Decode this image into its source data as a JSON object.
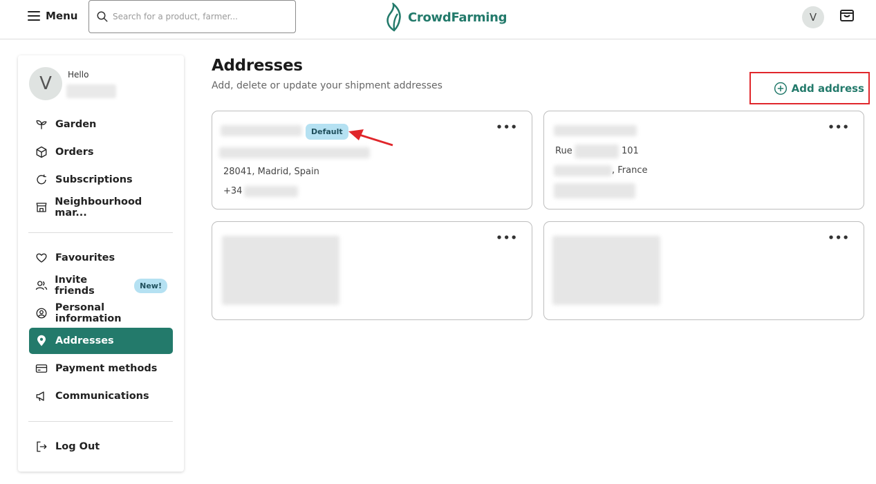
{
  "header": {
    "menu_label": "Menu",
    "search_placeholder": "Search for a product, farmer...",
    "brand": "CrowdFarming",
    "avatar_initial": "V"
  },
  "sidebar": {
    "avatar_initial": "V",
    "greeting": "Hello",
    "items": [
      {
        "label": "Garden",
        "icon": "sprout-icon"
      },
      {
        "label": "Orders",
        "icon": "box-icon"
      },
      {
        "label": "Subscriptions",
        "icon": "refresh-icon"
      },
      {
        "label": "Neighbourhood mar...",
        "icon": "store-icon"
      },
      {
        "label": "Favourites",
        "icon": "heart-icon"
      },
      {
        "label": "Invite friends",
        "icon": "users-icon",
        "badge": "New!"
      },
      {
        "label": "Personal information",
        "icon": "person-icon"
      },
      {
        "label": "Addresses",
        "icon": "location-pin-icon",
        "active": true
      },
      {
        "label": "Payment methods",
        "icon": "card-icon"
      },
      {
        "label": "Communications",
        "icon": "megaphone-icon"
      },
      {
        "label": "Log Out",
        "icon": "logout-icon"
      }
    ]
  },
  "main": {
    "title": "Addresses",
    "subtitle": "Add, delete or update your shipment addresses",
    "add_label": "Add address",
    "more_label": "•••",
    "cards": [
      {
        "badge": "Default",
        "line1": "28041, Madrid, Spain",
        "phone_prefix": "+34"
      },
      {
        "street_prefix": "Rue",
        "street_number": "101",
        "country_suffix": ", France"
      },
      {},
      {}
    ]
  },
  "colors": {
    "brand_green": "#237a6b",
    "badge_blue": "#b5e1f2",
    "highlight_red": "#e0262b"
  }
}
